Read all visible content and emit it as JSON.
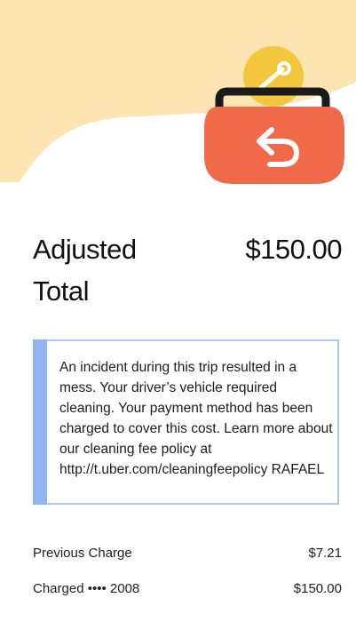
{
  "colors": {
    "hero_background": "#fde4b3",
    "wallet_body": "#f06a4a",
    "wallet_clasp": "#1a1a1a",
    "coin": "#f4c63d",
    "notice_border": "#a9c6ef",
    "notice_bar": "#8fb4ef"
  },
  "hero": {
    "illustration_icon": "wallet-refund-icon"
  },
  "total": {
    "label": "Adjusted Total",
    "amount": "$150.00"
  },
  "notice": {
    "text": "An incident during this trip resulted in a mess. Your driver’s vehicle required cleaning. Your payment method has been charged to cover this cost. Learn more about our cleaning fee policy at http://t.uber.com/cleaningfeepolicy RAFAEL"
  },
  "charges": [
    {
      "label": "Previous Charge",
      "value": "$7.21"
    },
    {
      "label": "Charged •••• 2008",
      "value": "$150.00"
    }
  ]
}
